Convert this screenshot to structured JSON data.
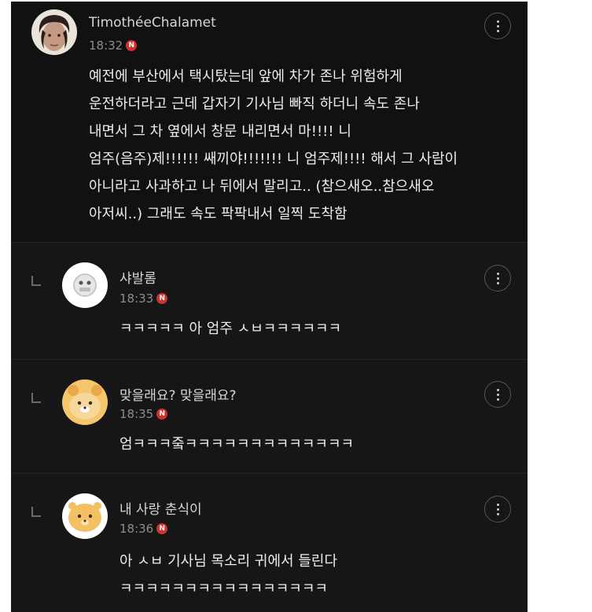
{
  "comments": [
    {
      "username": "TimothéeChalamet",
      "time": "18:32",
      "badge": "N",
      "text": "예전에 부산에서 택시탔는데 앞에 차가 존나 위험하게\n운전하더라고 근데 갑자기 기사님 빠직 하더니 속도 존나\n내면서 그 차 옆에서 창문 내리면서 마!!!! 니\n엄주(음주)제!!!!!! 쌔끼야!!!!!!! 니 엄주제!!!! 해서 그 사람이\n아니라고 사과하고 나 뒤에서 말리고.. (참으새오..참으새오\n아저씨..) 그래도 속도 팍팍내서 일찍 도착함"
    },
    {
      "username": "샤발롬",
      "time": "18:33",
      "badge": "N",
      "text": "ㅋㅋㅋㅋㅋ 아 엄주 ㅅㅂㅋㅋㅋㅋㅋㅋ"
    },
    {
      "username": "맞을래요? 맞을래요?",
      "time": "18:35",
      "badge": "N",
      "text": "엄ㅋㅋㅋ줔ㅋㅋㅋㅋㅋㅋㅋㅋㅋㅋㅋㅋㅋ"
    },
    {
      "username": "내 사랑 춘식이",
      "time": "18:36",
      "badge": "N",
      "text": "아 ㅅㅂ 기사님 목소리 귀에서 들린다\nㅋㅋㅋㅋㅋㅋㅋㅋㅋㅋㅋㅋㅋㅋㅋㅋ"
    }
  ],
  "colors": {
    "background": "#111111",
    "reply_background": "#161616",
    "badge": "#d2322d"
  }
}
